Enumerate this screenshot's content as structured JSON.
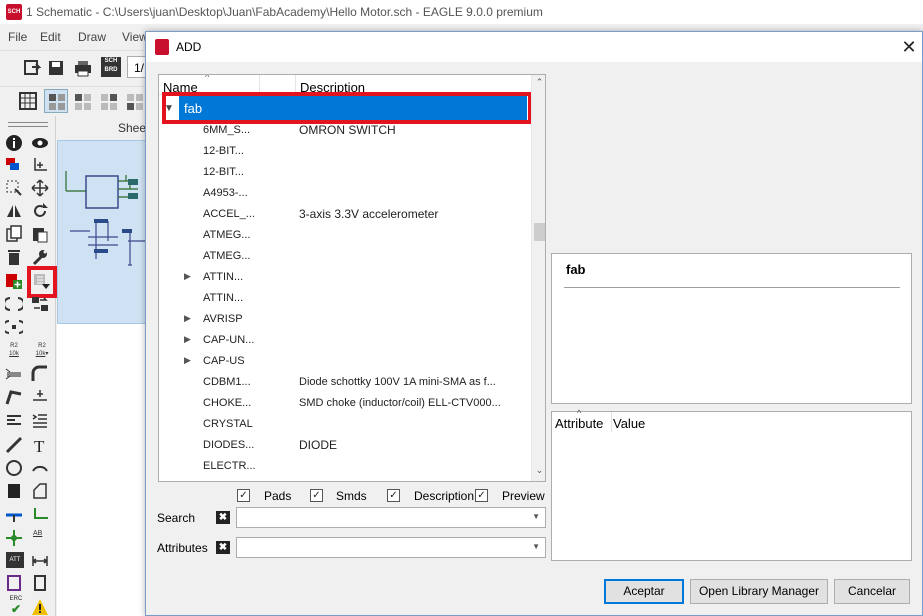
{
  "main_window": {
    "title": "1 Schematic - C:\\Users\\juan\\Desktop\\Juan\\FabAcademy\\Hello Motor.sch - EAGLE 9.0.0 premium",
    "menu": [
      "File",
      "Edit",
      "Draw",
      "View"
    ],
    "sheet_field": "1/",
    "sheet_tab": "Sheet",
    "icon_badges": {
      "sch_brd": "SCH BRD",
      "erc": "ERC"
    }
  },
  "dialog": {
    "title": "ADD",
    "tree": {
      "columns": {
        "name": "Name",
        "description": "Description"
      },
      "library": {
        "name": "fab",
        "expanded": true,
        "selected": true
      },
      "rows": [
        {
          "name": "6MM_S...",
          "description": "OMRON SWITCH",
          "expandable": false
        },
        {
          "name": "12-BIT...",
          "description": "",
          "expandable": false
        },
        {
          "name": "12-BIT...",
          "description": "",
          "expandable": false
        },
        {
          "name": "A4953-...",
          "description": "",
          "expandable": false
        },
        {
          "name": "ACCEL_...",
          "description": "3-axis 3.3V accelerometer",
          "expandable": false
        },
        {
          "name": "ATMEG...",
          "description": "",
          "expandable": false
        },
        {
          "name": "ATMEG...",
          "description": "",
          "expandable": false
        },
        {
          "name": "ATTIN...",
          "description": "",
          "expandable": true
        },
        {
          "name": "ATTIN...",
          "description": "",
          "expandable": false
        },
        {
          "name": "AVRISP",
          "description": "",
          "expandable": true
        },
        {
          "name": "CAP-UN...",
          "description": "",
          "expandable": true
        },
        {
          "name": "CAP-US",
          "description": "",
          "expandable": true
        },
        {
          "name": "CDBM1...",
          "description": "Diode schottky 100V 1A mini-SMA as f...",
          "expandable": false
        },
        {
          "name": "CHOKE...",
          "description": "SMD choke (inductor/coil) ELL-CTV000...",
          "expandable": false
        },
        {
          "name": "CRYSTAL",
          "description": "",
          "expandable": false
        },
        {
          "name": "DIODES...",
          "description": "DIODE",
          "expandable": false
        },
        {
          "name": "ELECTR...",
          "description": "",
          "expandable": false
        }
      ]
    },
    "filters": [
      {
        "label": "Pads",
        "checked": true
      },
      {
        "label": "Smds",
        "checked": true
      },
      {
        "label": "Description",
        "checked": true
      },
      {
        "label": "Preview",
        "checked": true
      }
    ],
    "search": {
      "label": "Search",
      "value": "",
      "placeholder": ""
    },
    "attributes": {
      "label": "Attributes",
      "value": "",
      "placeholder": ""
    },
    "preview": {
      "title": "fab"
    },
    "attribute_table": {
      "columns": {
        "attribute": "Attribute",
        "value": "Value"
      }
    },
    "buttons": {
      "accept": "Aceptar",
      "library_manager": "Open Library Manager",
      "cancel": "Cancelar"
    }
  },
  "colors": {
    "selection": "#0078d7",
    "highlight": "#e3141f",
    "canvas": "#cfe2f3"
  }
}
